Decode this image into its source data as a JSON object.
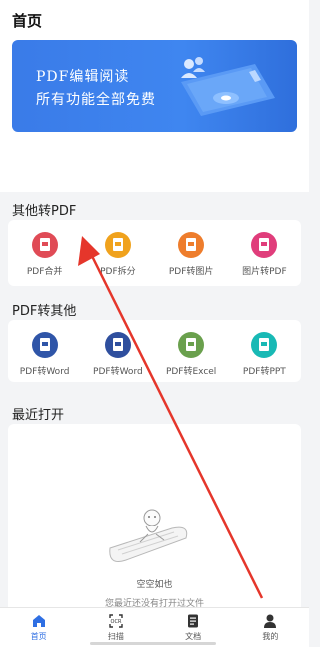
{
  "header": {
    "title": "首页"
  },
  "banner": {
    "line1": "PDF编辑阅读",
    "line2": "所有功能全部免费"
  },
  "sections": {
    "other_to_pdf": {
      "title": "其他转PDF",
      "items": [
        {
          "label": "PDF合并",
          "icon": "pdf-merge-icon",
          "color": "#e04b56"
        },
        {
          "label": "PDF拆分",
          "icon": "pdf-split-icon",
          "color": "#f0a21d"
        },
        {
          "label": "PDF转图片",
          "icon": "pdf-to-image-icon",
          "color": "#ee7d2c"
        },
        {
          "label": "图片转PDF",
          "icon": "image-to-pdf-icon",
          "color": "#e03d7b"
        }
      ]
    },
    "pdf_to_other": {
      "title": "PDF转其他",
      "items": [
        {
          "label": "PDF转Word",
          "icon": "pdf-to-word-icon",
          "color": "#2f55a8"
        },
        {
          "label": "PDF转Word",
          "icon": "pdf-to-word-icon",
          "color": "#2f4f9e"
        },
        {
          "label": "PDF转Excel",
          "icon": "pdf-to-excel-icon",
          "color": "#6aa04d"
        },
        {
          "label": "PDF转PPT",
          "icon": "pdf-to-ppt-icon",
          "color": "#18b9b5"
        }
      ]
    },
    "recent": {
      "title": "最近打开",
      "empty_title": "空空如也",
      "empty_subtitle": "您最近还没有打开过文件"
    }
  },
  "tabbar": {
    "items": [
      {
        "label": "首页",
        "icon": "home-icon",
        "active": true
      },
      {
        "label": "扫描",
        "icon": "scan-icon",
        "active": false
      },
      {
        "label": "文档",
        "icon": "document-icon",
        "active": false
      },
      {
        "label": "我的",
        "icon": "profile-icon",
        "active": false
      }
    ]
  },
  "colors": {
    "accent": "#2f6fe3",
    "banner": "#3f86f0",
    "annotation_arrow": "#e5362b"
  }
}
